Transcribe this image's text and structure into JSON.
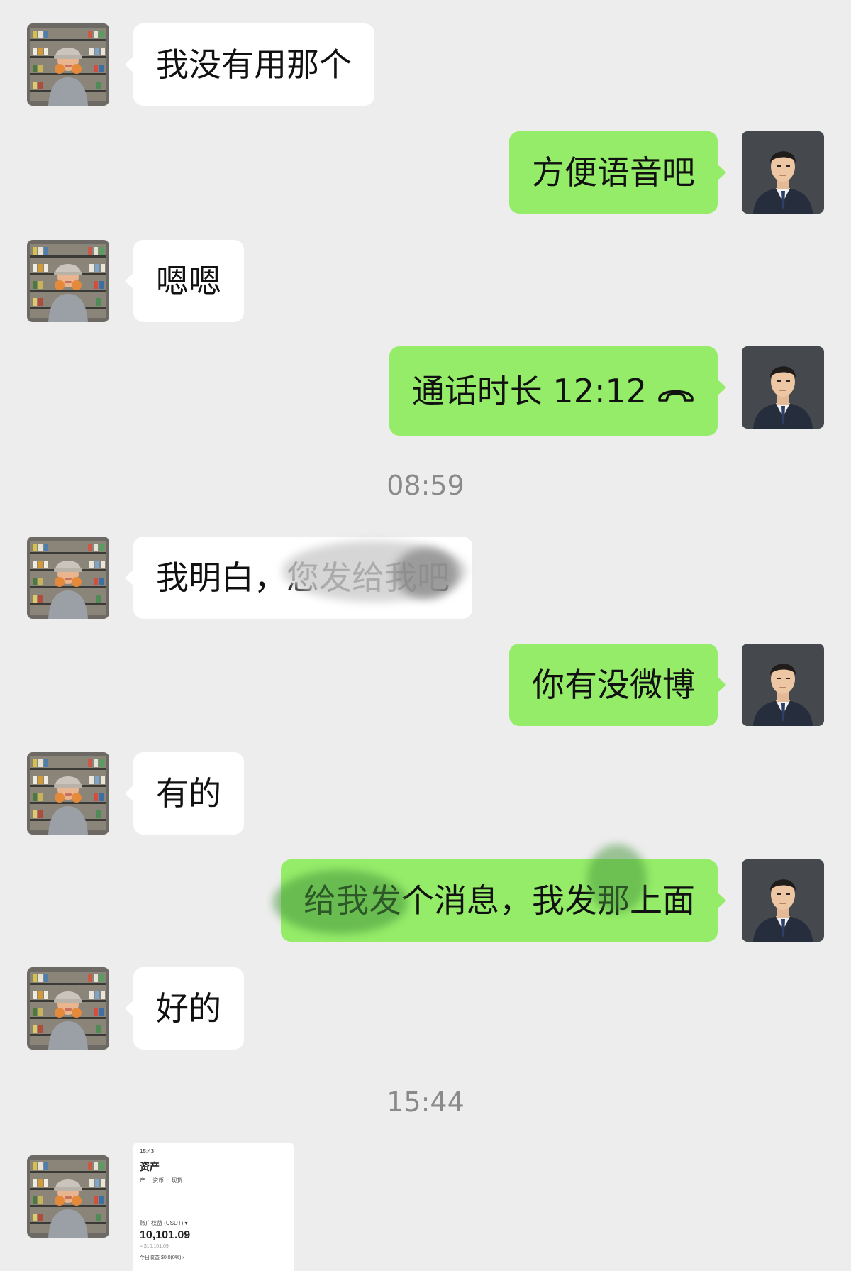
{
  "messages": [
    {
      "side": "in",
      "text": "我没有用那个"
    },
    {
      "side": "out",
      "text": "方便语音吧"
    },
    {
      "side": "in",
      "text": "嗯嗯"
    },
    {
      "side": "out",
      "text": "通话时长 12:12",
      "icon": "phone-hangup-icon"
    },
    {
      "side": "in",
      "text": "我明白，您发给我吧"
    },
    {
      "side": "out",
      "text": "你有没微博"
    },
    {
      "side": "in",
      "text": "有的"
    },
    {
      "side": "out",
      "text": "给我发个消息，我发那上面"
    },
    {
      "side": "in",
      "text": "好的"
    }
  ],
  "timestamps": [
    "08:59",
    "15:44"
  ],
  "screenshot": {
    "time": "15:43",
    "title": "资产",
    "tabs": "产 资币 现货",
    "equity_label": "账户权益 (USDT) ▾",
    "equity_value": "10,101.09",
    "equity_sub": "≈ $10,101.09",
    "today_pnl": "今日收益 $0.0(0%) ›"
  },
  "colors": {
    "background": "#ededed",
    "incoming_bubble": "#ffffff",
    "outgoing_bubble": "#95ec69",
    "timestamp": "#8a8a8a"
  }
}
